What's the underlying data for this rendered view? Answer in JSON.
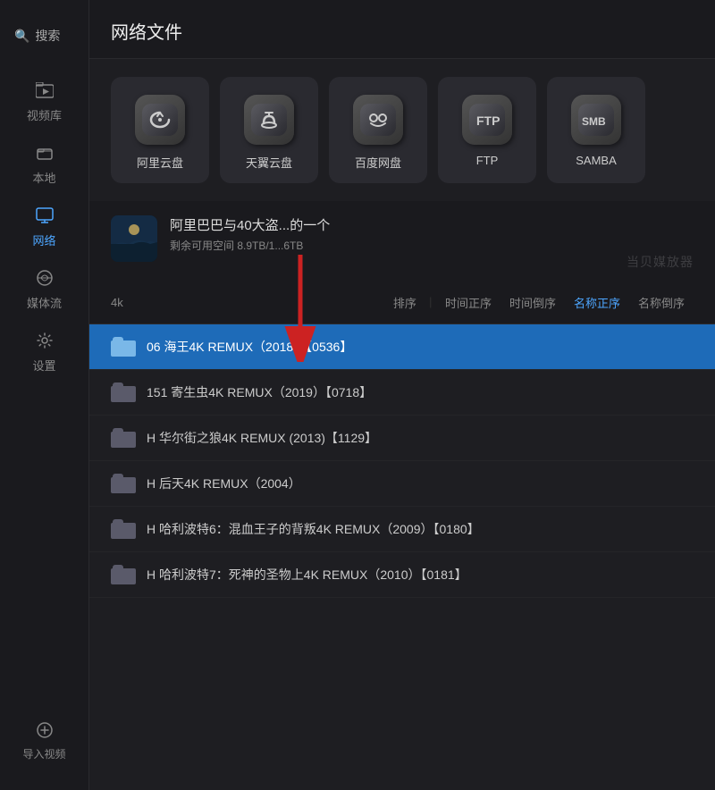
{
  "sidebar": {
    "search_label": "搜索",
    "items": [
      {
        "id": "video-lib",
        "label": "视频库",
        "icon": "▶"
      },
      {
        "id": "local",
        "label": "本地",
        "icon": "📁"
      },
      {
        "id": "network",
        "label": "网络",
        "icon": "🌐",
        "active": true
      },
      {
        "id": "media-stream",
        "label": "媒体流",
        "icon": "📡"
      },
      {
        "id": "settings",
        "label": "设置",
        "icon": "⚙"
      }
    ],
    "import_label": "导入视频",
    "import_icon": "⊕"
  },
  "header": {
    "title": "网络文件"
  },
  "cloud_services": [
    {
      "id": "aliyun",
      "label": "阿里云盘",
      "icon_type": "ali"
    },
    {
      "id": "tianyi",
      "label": "天翼云盘",
      "icon_type": "tianyi"
    },
    {
      "id": "baidu",
      "label": "百度网盘",
      "icon_type": "baidu"
    },
    {
      "id": "ftp",
      "label": "FTP",
      "icon_type": "ftp"
    },
    {
      "id": "samba",
      "label": "SAMBA",
      "icon_type": "samba"
    }
  ],
  "profile": {
    "name": "阿里巴巴与40大盗...的一个",
    "space": "剩余可用空间 8.9TB/1...6TB",
    "thumb_label": "profile-thumbnail"
  },
  "watermark": "当贝媒放器",
  "sort_bar": {
    "label_4k": "4k",
    "options": [
      {
        "id": "sort-default",
        "label": "排序",
        "active": false
      },
      {
        "id": "sort-time-asc",
        "label": "时间正序",
        "active": false
      },
      {
        "id": "sort-time-desc",
        "label": "时间倒序",
        "active": false
      },
      {
        "id": "sort-name-asc",
        "label": "名称正序",
        "active": true
      },
      {
        "id": "sort-name-desc",
        "label": "名称倒序",
        "active": false
      }
    ]
  },
  "files": [
    {
      "id": 1,
      "name": "06 海王4K REMUX（2018）【0536】",
      "selected": true
    },
    {
      "id": 2,
      "name": "151 寄生虫4K REMUX（2019）【0718】",
      "selected": false
    },
    {
      "id": 3,
      "name": "H 华尔街之狼4K REMUX (2013)【1129】",
      "selected": false
    },
    {
      "id": 4,
      "name": "H 后天4K REMUX（2004）",
      "selected": false
    },
    {
      "id": 5,
      "name": "H 哈利波特6：混血王子的背叛4K REMUX（2009）【0180】",
      "selected": false
    },
    {
      "id": 6,
      "name": "H 哈利波特7：死神的圣物上4K REMUX（2010）【0181】",
      "selected": false
    }
  ]
}
